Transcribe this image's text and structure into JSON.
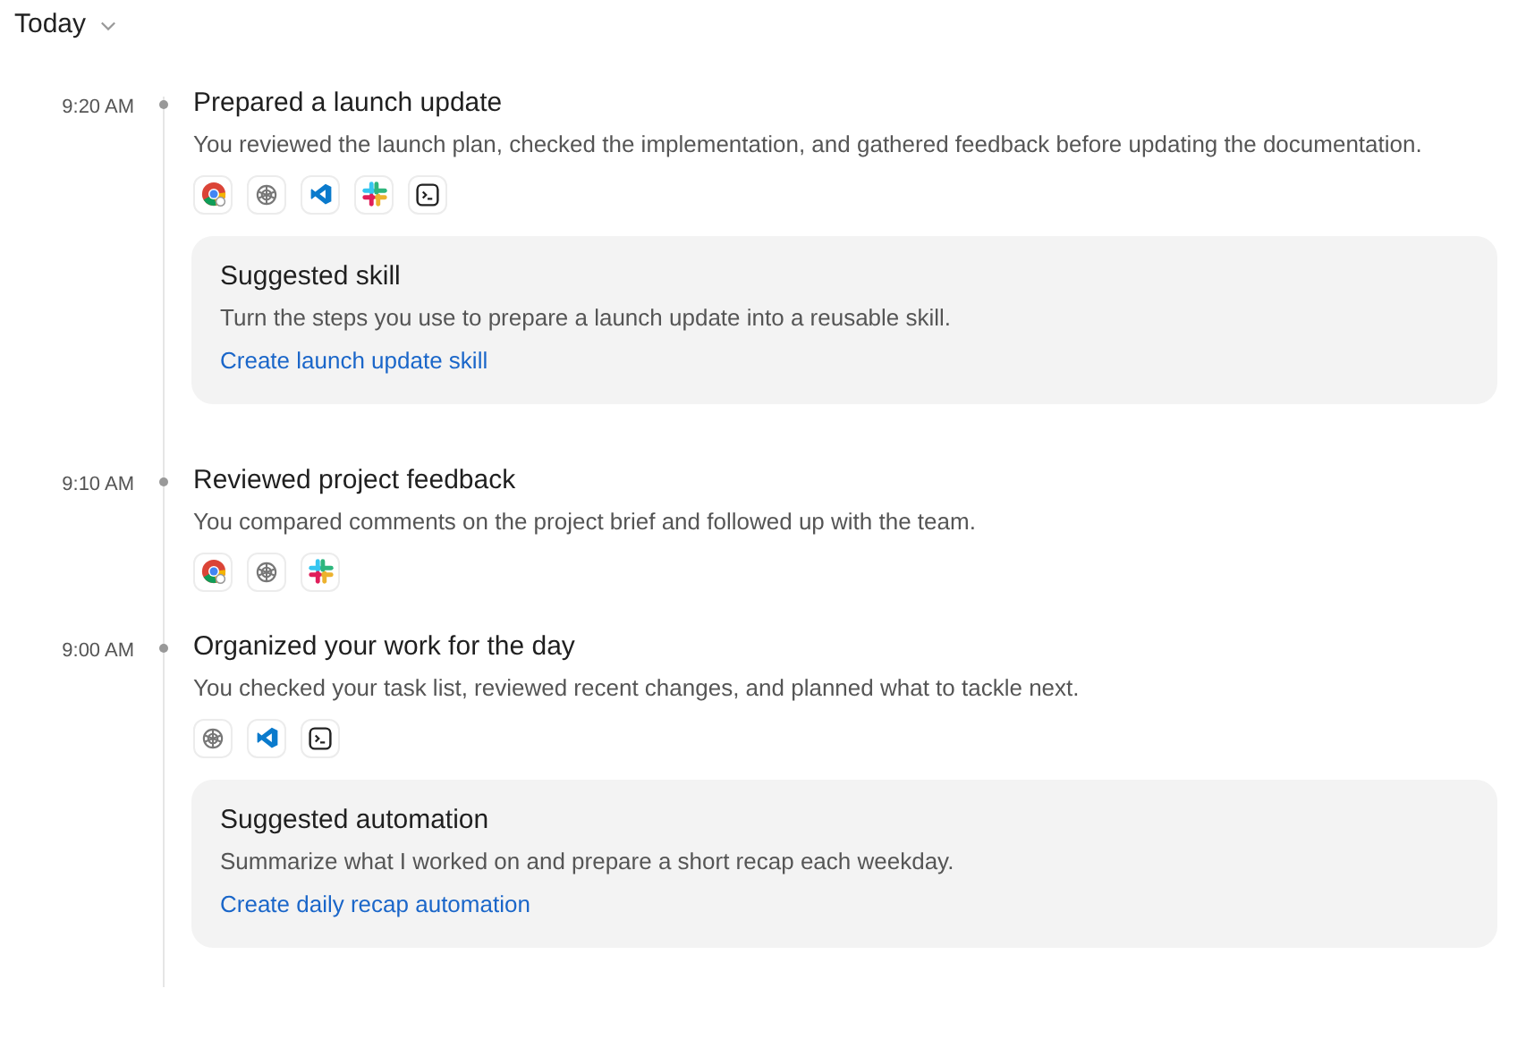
{
  "header": {
    "title": "Today",
    "expanded": true
  },
  "entries": [
    {
      "time": "9:20 AM",
      "title": "Prepared a launch update",
      "description": "You reviewed the launch plan, checked the implementation, and gathered feedback before updating the documentation.",
      "apps": [
        {
          "kind": "browser"
        },
        {
          "kind": "knot"
        },
        {
          "kind": "editor"
        },
        {
          "kind": "chat"
        },
        {
          "kind": "terminal"
        }
      ],
      "suggestion": {
        "title": "Suggested skill",
        "text": "Turn the steps you use to prepare a launch update into a reusable skill.",
        "link": "Create launch update skill"
      }
    },
    {
      "time": "9:10 AM",
      "title": "Reviewed project feedback",
      "description": "You compared comments on the project brief and followed up with the team.",
      "apps": [
        {
          "kind": "browser"
        },
        {
          "kind": "knot"
        },
        {
          "kind": "chat"
        }
      ]
    },
    {
      "time": "9:00 AM",
      "title": "Organized your work for the day",
      "description": "You checked your task list, reviewed recent changes, and planned what to tackle next.",
      "apps": [
        {
          "kind": "knot"
        },
        {
          "kind": "editor"
        },
        {
          "kind": "terminal"
        }
      ],
      "suggestion": {
        "title": "Suggested automation",
        "text": "Summarize what I worked on and prepare a short recap each weekday.",
        "link": "Create daily recap automation"
      }
    }
  ]
}
